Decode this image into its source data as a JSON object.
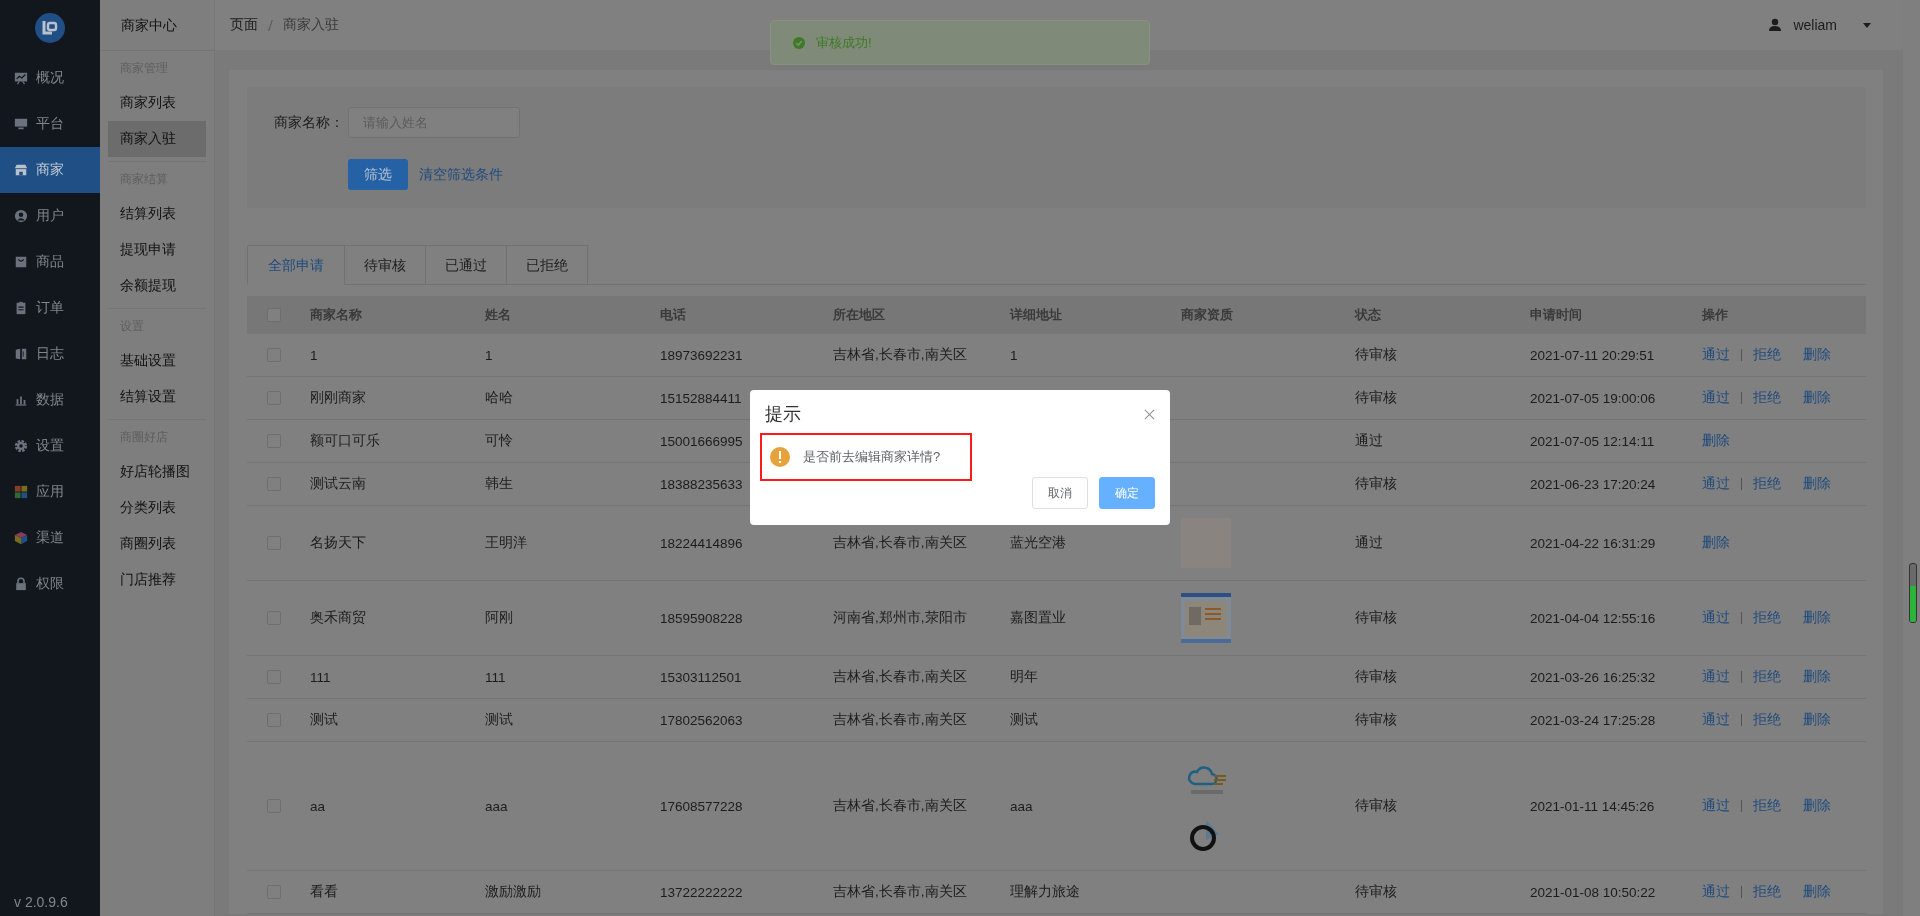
{
  "sidebar": {
    "items": [
      {
        "label": "概况",
        "selected": false
      },
      {
        "label": "平台",
        "selected": false
      },
      {
        "label": "商家",
        "selected": true
      },
      {
        "label": "用户",
        "selected": false
      },
      {
        "label": "商品",
        "selected": false
      },
      {
        "label": "订单",
        "selected": false
      },
      {
        "label": "日志",
        "selected": false
      },
      {
        "label": "数据",
        "selected": false
      },
      {
        "label": "设置",
        "selected": false
      },
      {
        "label": "应用",
        "selected": false
      },
      {
        "label": "渠道",
        "selected": false
      },
      {
        "label": "权限",
        "selected": false
      }
    ],
    "version": "v 2.0.9.6"
  },
  "subnav": {
    "title": "商家中心",
    "groups": [
      {
        "heading": "商家管理",
        "items": [
          {
            "label": "商家列表",
            "selected": false
          },
          {
            "label": "商家入驻",
            "selected": true
          }
        ]
      },
      {
        "heading": "商家结算",
        "items": [
          {
            "label": "结算列表",
            "selected": false
          },
          {
            "label": "提现申请",
            "selected": false
          },
          {
            "label": "余额提现",
            "selected": false
          }
        ]
      },
      {
        "heading": "设置",
        "items": [
          {
            "label": "基础设置",
            "selected": false
          },
          {
            "label": "结算设置",
            "selected": false
          }
        ]
      },
      {
        "heading": "商圈好店",
        "items": [
          {
            "label": "好店轮播图",
            "selected": false
          },
          {
            "label": "分类列表",
            "selected": false
          },
          {
            "label": "商圈列表",
            "selected": false
          },
          {
            "label": "门店推荐",
            "selected": false
          }
        ]
      }
    ]
  },
  "header": {
    "breadcrumb": [
      "页面",
      "商家入驻"
    ],
    "user": "weliam"
  },
  "toast": {
    "message": "审核成功!"
  },
  "filter": {
    "label": "商家名称：",
    "placeholder": "请输入姓名",
    "submit": "筛选",
    "clear": "清空筛选条件"
  },
  "tabs": [
    {
      "label": "全部申请",
      "selected": true
    },
    {
      "label": "待审核",
      "selected": false
    },
    {
      "label": "已通过",
      "selected": false
    },
    {
      "label": "已拒绝",
      "selected": false
    }
  ],
  "table": {
    "select_all": false,
    "columns": [
      "商家名称",
      "姓名",
      "电话",
      "所在地区",
      "详细地址",
      "商家资质",
      "状态",
      "申请时间",
      "操作"
    ],
    "rows": [
      {
        "checked": false,
        "name": "1",
        "contact": "1",
        "phone": "18973692231",
        "region": "吉林省,长春市,南关区",
        "address": "1",
        "images": [],
        "status": "待审核",
        "time": "2021-07-11 20:29:51",
        "actions": [
          "通过",
          "拒绝",
          "删除"
        ]
      },
      {
        "checked": false,
        "name": "刚刚商家",
        "contact": "哈哈",
        "phone": "15152884411",
        "region": "",
        "address": "",
        "images": [],
        "status": "待审核",
        "time": "2021-07-05 19:00:06",
        "actions": [
          "通过",
          "拒绝",
          "删除"
        ]
      },
      {
        "checked": false,
        "name": "额可口可乐",
        "contact": "可怜",
        "phone": "15001666995",
        "region": "",
        "address": "",
        "images": [],
        "status": "通过",
        "time": "2021-07-05 12:14:11",
        "actions": [
          "删除"
        ]
      },
      {
        "checked": false,
        "name": "测试云南",
        "contact": "韩生",
        "phone": "18388235633",
        "region": "",
        "address": "",
        "images": [],
        "status": "待审核",
        "time": "2021-06-23 17:20:24",
        "actions": [
          "通过",
          "拒绝",
          "删除"
        ]
      },
      {
        "checked": false,
        "name": "名扬天下",
        "contact": "王明洋",
        "phone": "18224414896",
        "region": "吉林省,长春市,南关区",
        "address": "蓝光空港",
        "images": [
          {
            "kind": "photo"
          }
        ],
        "status": "通过",
        "time": "2021-04-22 16:31:29",
        "actions": [
          "删除"
        ]
      },
      {
        "checked": false,
        "name": "奥禾商贸",
        "contact": "阿刚",
        "phone": "18595908228",
        "region": "河南省,郑州市,荥阳市",
        "address": "嘉图置业",
        "images": [
          {
            "kind": "document"
          }
        ],
        "status": "待审核",
        "time": "2021-04-04 12:55:16",
        "actions": [
          "通过",
          "拒绝",
          "删除"
        ]
      },
      {
        "checked": false,
        "name": "111",
        "contact": "111",
        "phone": "15303112501",
        "region": "吉林省,长春市,南关区",
        "address": "明年",
        "images": [],
        "status": "待审核",
        "time": "2021-03-26 16:25:32",
        "actions": [
          "通过",
          "拒绝",
          "删除"
        ]
      },
      {
        "checked": false,
        "name": "测试",
        "contact": "测试",
        "phone": "17802562063",
        "region": "吉林省,长春市,南关区",
        "address": "测试",
        "images": [],
        "status": "待审核",
        "time": "2021-03-24 17:25:28",
        "actions": [
          "通过",
          "拒绝",
          "删除"
        ]
      },
      {
        "checked": false,
        "name": "aa",
        "contact": "aaa",
        "phone": "17608577228",
        "region": "吉林省,长春市,南关区",
        "address": "aaa",
        "images": [
          {
            "kind": "cloud-logo"
          },
          {
            "kind": "ring-logo"
          }
        ],
        "status": "待审核",
        "time": "2021-01-11 14:45:26",
        "actions": [
          "通过",
          "拒绝",
          "删除"
        ]
      },
      {
        "checked": false,
        "name": "看看",
        "contact": "激励激励",
        "phone": "13722222222",
        "region": "吉林省,长春市,南关区",
        "address": "理解力旅途",
        "images": [],
        "status": "待审核",
        "time": "2021-01-08 10:50:22",
        "actions": [
          "通过",
          "拒绝",
          "删除"
        ]
      }
    ]
  },
  "dialog": {
    "title": "提示",
    "message": "是否前去编辑商家详情?",
    "highlighted": true,
    "cancel": "取消",
    "confirm": "确定"
  }
}
